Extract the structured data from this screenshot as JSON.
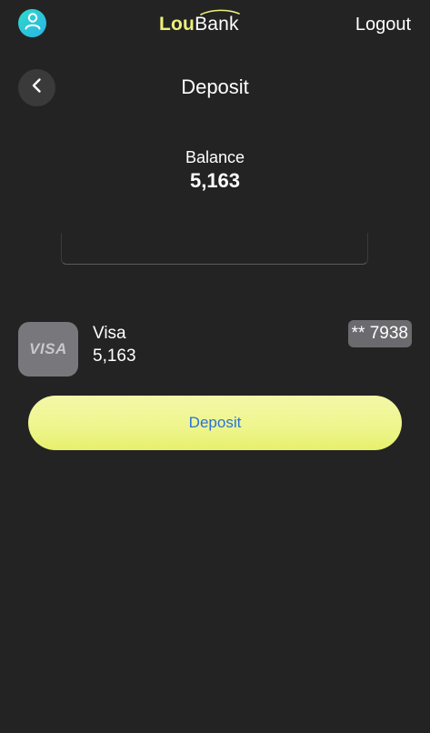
{
  "header": {
    "brand_lou": "Lou",
    "brand_bank": "Bank",
    "logout_label": "Logout",
    "profile_icon": "user-icon"
  },
  "page": {
    "title": "Deposit",
    "back_icon": "chevron-left-icon"
  },
  "balance": {
    "label": "Balance",
    "value": "5,163"
  },
  "amount_input": {
    "value": "",
    "placeholder": ""
  },
  "card": {
    "logo_text": "VISA",
    "name": "Visa",
    "amount": "5,163",
    "number_masked": "** 7938"
  },
  "actions": {
    "deposit_label": "Deposit"
  },
  "colors": {
    "background": "#232323",
    "brand_accent": "#eef07a",
    "button_text": "#2a73d6",
    "profile_gradient_start": "#2fd9c8",
    "profile_gradient_end": "#29b4e8"
  }
}
